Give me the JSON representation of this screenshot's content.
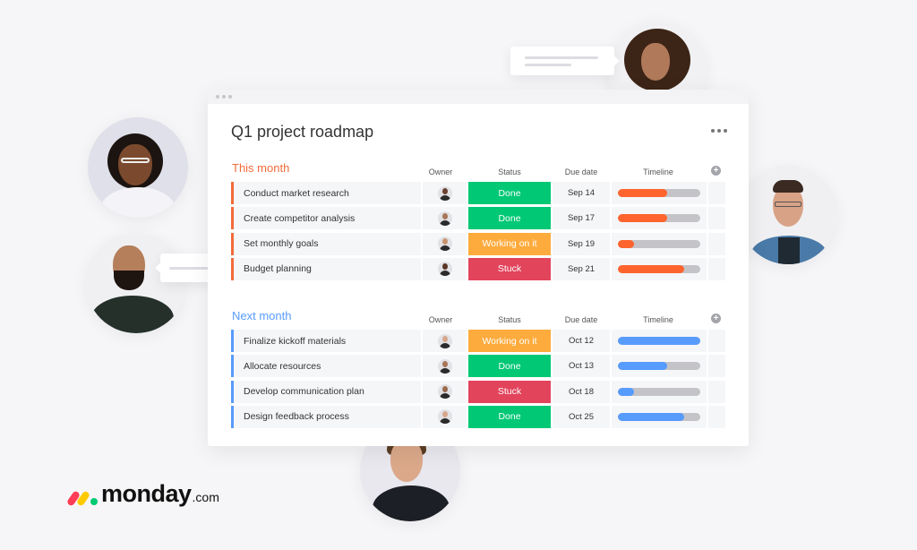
{
  "board": {
    "title": "Q1 project roadmap",
    "more_label": "More options",
    "add_column_label": "+",
    "columns": {
      "owner": "Owner",
      "status": "Status",
      "due_date": "Due date",
      "timeline": "Timeline"
    },
    "groups": [
      {
        "title": "This month",
        "color": "#f26b3a",
        "items": [
          {
            "name": "Conduct market research",
            "status": "Done",
            "status_color": "#00c875",
            "due": "Sep 14",
            "timeline_progress": 0.6,
            "owner": "woman-curly-hair"
          },
          {
            "name": "Create competitor analysis",
            "status": "Done",
            "status_color": "#00c875",
            "due": "Sep 17",
            "timeline_progress": 0.6,
            "owner": "man-bald-beard"
          },
          {
            "name": "Set monthly goals",
            "status": "Working on it",
            "status_color": "#fdab3d",
            "due": "Sep 19",
            "timeline_progress": 0.2,
            "owner": "woman-long-hair"
          },
          {
            "name": "Budget planning",
            "status": "Stuck",
            "status_color": "#e2445c",
            "due": "Sep 21",
            "timeline_progress": 0.8,
            "owner": "woman-afro"
          }
        ]
      },
      {
        "title": "Next month",
        "color": "#579bfc",
        "items": [
          {
            "name": "Finalize kickoff materials",
            "status": "Working on it",
            "status_color": "#fdab3d",
            "due": "Oct 12",
            "timeline_progress": 1.0,
            "owner": "man-curly-hair"
          },
          {
            "name": "Allocate resources",
            "status": "Done",
            "status_color": "#00c875",
            "due": "Oct 13",
            "timeline_progress": 0.6,
            "owner": "man-bald-beard"
          },
          {
            "name": "Develop communication plan",
            "status": "Stuck",
            "status_color": "#e2445c",
            "due": "Oct 18",
            "timeline_progress": 0.2,
            "owner": "man-bald-beard-2"
          },
          {
            "name": "Design feedback process",
            "status": "Done",
            "status_color": "#00c875",
            "due": "Oct 25",
            "timeline_progress": 0.8,
            "owner": "man-glasses"
          }
        ]
      }
    ]
  },
  "brand": {
    "name": "monday",
    "tld": ".com",
    "colors": [
      "#ff3d57",
      "#ffcb00",
      "#00ca72"
    ]
  },
  "people": [
    "woman-glasses-smiling",
    "man-beard-green-shirt",
    "woman-curly-hair",
    "man-glasses-denim",
    "man-curly-hair"
  ]
}
